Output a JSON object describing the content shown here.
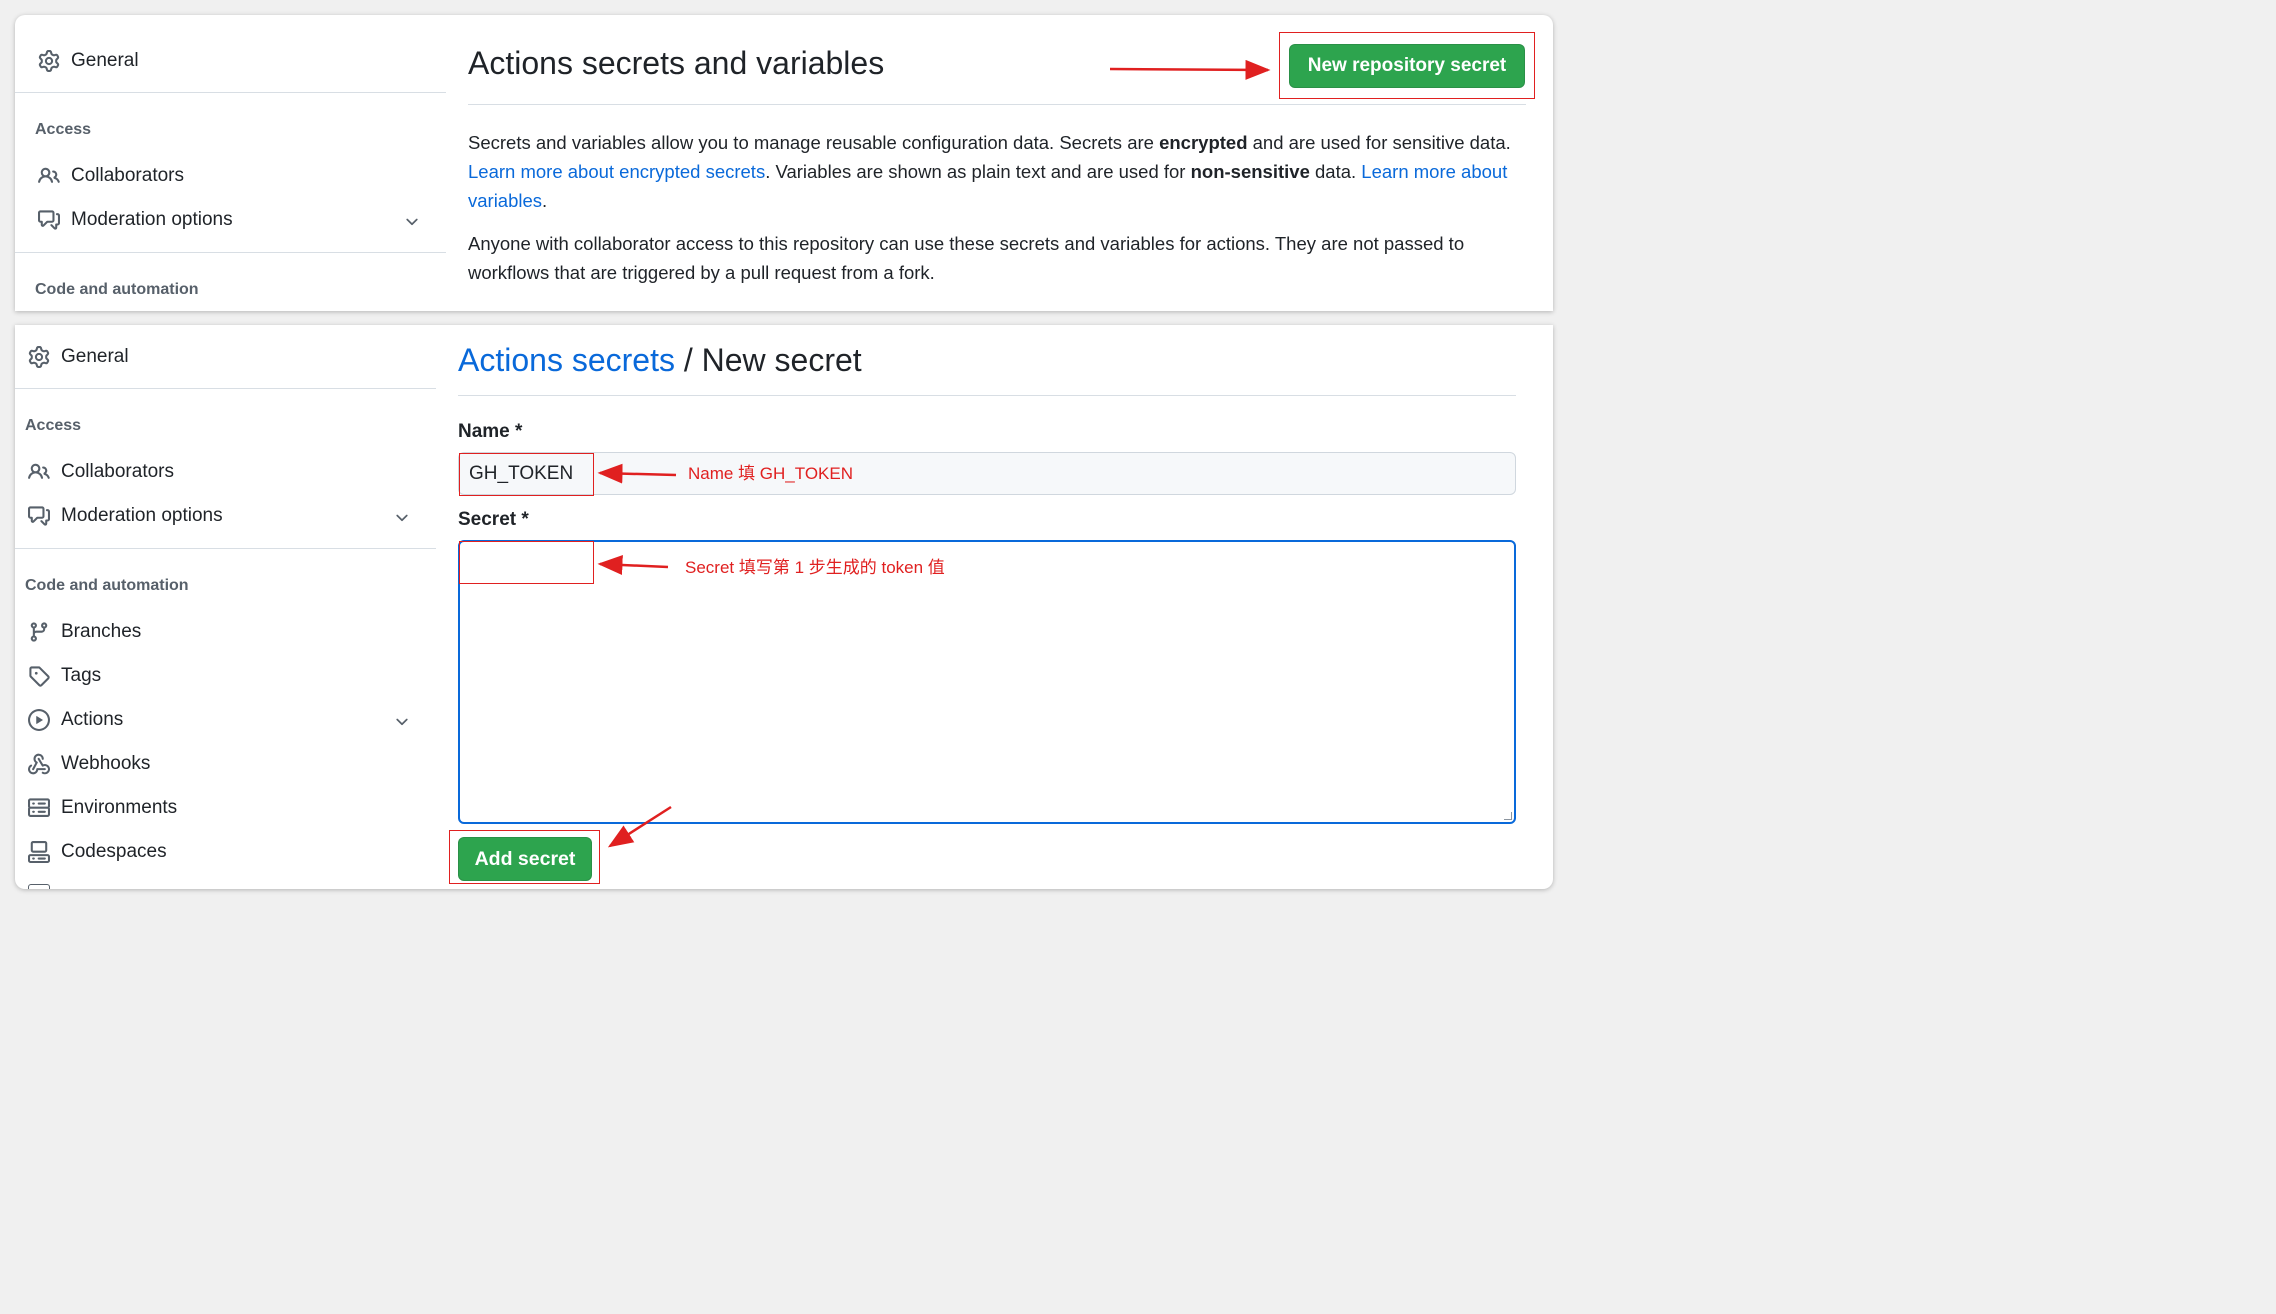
{
  "top": {
    "sidebar": {
      "general": "General",
      "access_heading": "Access",
      "items": [
        {
          "label": "Collaborators",
          "icon": "people-icon"
        },
        {
          "label": "Moderation options",
          "icon": "comment-discussion-icon"
        }
      ],
      "code_heading": "Code and automation"
    },
    "title": "Actions secrets and variables",
    "new_secret_button": "New repository secret",
    "para1": {
      "t1": "Secrets and variables allow you to manage reusable configuration data. Secrets are ",
      "b1": "encrypted",
      "t2": " and are used for sensitive data. ",
      "link1": "Learn more about encrypted secrets",
      "t3": ". Variables are shown as plain text and are used for ",
      "b2": "non-sensitive",
      "t4": " data. ",
      "link2": "Learn more about variables",
      "t5": "."
    },
    "para2": "Anyone with collaborator access to this repository can use these secrets and variables for actions. They are not passed to workflows that are triggered by a pull request from a fork."
  },
  "bottom": {
    "sidebar": {
      "general": "General",
      "access_heading": "Access",
      "items_access": [
        {
          "label": "Collaborators",
          "icon": "people-icon"
        },
        {
          "label": "Moderation options",
          "icon": "comment-discussion-icon"
        }
      ],
      "code_heading": "Code and automation",
      "items_code": [
        {
          "label": "Branches",
          "icon": "git-branch-icon"
        },
        {
          "label": "Tags",
          "icon": "tag-icon"
        },
        {
          "label": "Actions",
          "icon": "play-icon"
        },
        {
          "label": "Webhooks",
          "icon": "webhook-icon"
        },
        {
          "label": "Environments",
          "icon": "server-icon"
        },
        {
          "label": "Codespaces",
          "icon": "codespaces-icon"
        }
      ]
    },
    "breadcrumb_link": "Actions secrets",
    "breadcrumb_sep": " / ",
    "breadcrumb_current": "New secret",
    "name_label": "Name *",
    "name_value": "GH_TOKEN",
    "secret_label": "Secret *",
    "secret_value": "",
    "add_button": "Add secret"
  },
  "annotations": {
    "name_note": "Name 填 GH_TOKEN",
    "secret_note": "Secret 填写第 1 步生成的 token 值"
  },
  "colors": {
    "accent_blue": "#0969da",
    "button_green": "#2da44e",
    "annotation_red": "#e02020"
  }
}
